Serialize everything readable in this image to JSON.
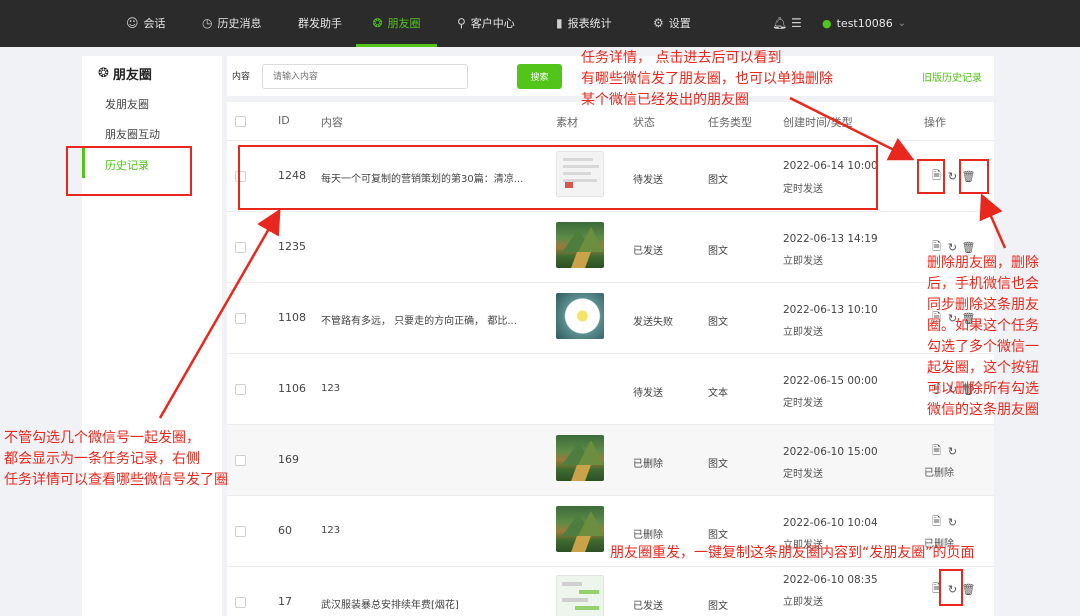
{
  "nav": {
    "items": [
      {
        "icon": "chat-icon",
        "glyph": "☺",
        "label": "会话"
      },
      {
        "icon": "clock-icon",
        "glyph": "◷",
        "label": "历史消息"
      },
      {
        "icon": "",
        "glyph": "",
        "label": "群发助手"
      },
      {
        "icon": "moments-icon",
        "glyph": "❂",
        "label": "朋友圈",
        "active": true
      },
      {
        "icon": "user-icon",
        "glyph": "⚲",
        "label": "客户中心"
      },
      {
        "icon": "bar-chart-icon",
        "glyph": "▮",
        "label": "报表统计"
      },
      {
        "icon": "gear-icon",
        "glyph": "⚙",
        "label": "设置"
      }
    ],
    "username": "test10086"
  },
  "sidebar": {
    "title": "朋友圈",
    "items": [
      "发朋友圈",
      "朋友圈互动",
      "历史记录"
    ],
    "active_index": 2
  },
  "search": {
    "label": "内容",
    "placeholder": "请输入内容",
    "button": "搜索",
    "old_history_link": "旧版历史记录"
  },
  "table": {
    "headers": {
      "id": "ID",
      "content": "内容",
      "material": "素材",
      "status": "状态",
      "task_type": "任务类型",
      "created": "创建时间/类型",
      "actions": "操作"
    },
    "rows": [
      {
        "id": "1248",
        "content": "每天一个可复制的营销策划的第30篇：清凉...",
        "thumb": "doc",
        "status": "待发送",
        "type": "图文",
        "time": "2022-06-14 10:00",
        "mode": "定时发送",
        "ops": "doc-refresh-delete"
      },
      {
        "id": "1235",
        "content": "",
        "thumb": "landscape",
        "status": "已发送",
        "type": "图文",
        "time": "2022-06-13 14:19",
        "mode": "立即发送",
        "ops": "doc-refresh-delete"
      },
      {
        "id": "1108",
        "content": "不管路有多远， 只要走的方向正确， 都比...",
        "thumb": "daisy",
        "status": "发送失败",
        "type": "图文",
        "time": "2022-06-13 10:10",
        "mode": "立即发送",
        "ops": "doc-refresh-delete"
      },
      {
        "id": "1106",
        "content": "123",
        "thumb": "",
        "status": "待发送",
        "type": "文本",
        "time": "2022-06-15 00:00",
        "mode": "定时发送",
        "ops": "doc-refresh-delete"
      },
      {
        "id": "169",
        "content": "",
        "thumb": "landscape",
        "status": "已删除",
        "type": "图文",
        "time": "2022-06-10 15:00",
        "mode": "定时发送",
        "ops": "doc-refresh",
        "deleted_label": "已删除"
      },
      {
        "id": "60",
        "content": "123",
        "thumb": "landscape",
        "status": "已删除",
        "type": "图文",
        "time": "2022-06-10 10:04",
        "mode": "立即发送",
        "ops": "doc-refresh",
        "deleted_label": "已删除"
      },
      {
        "id": "17",
        "content": "武汉服装暴总安排续年费[烟花]",
        "thumb": "chat",
        "status": "已发送",
        "type": "图文",
        "time": "2022-06-10 08:35",
        "mode": "立即发送",
        "ops": "doc-refresh-delete"
      }
    ]
  },
  "annotations": {
    "top": [
      "任务详情，  点击进去后可以看到",
      "有哪些微信发了朋友圈，也可以单独删除",
      "某个微信已经发出的朋友圈"
    ],
    "right": [
      "删除朋友圈，删除",
      "后，手机微信也会",
      "同步删除这条朋友",
      "圈。如果这个任务",
      "勾选了多个微信一",
      "起发圈，这个按钮",
      "可以删除所有勾选",
      "微信的这条朋友圈"
    ],
    "left": [
      "不管勾选几个微信号一起发圈，",
      "都会显示为一条任务记录，右侧",
      "任务详情可以查看哪些微信号发了圈"
    ],
    "bottom": "朋友圈重发，一键复制这条朋友圈内容到“发朋友圈”的页面"
  },
  "colors": {
    "accent": "#52c41a",
    "annotation": "#e8281e",
    "topbar": "#2b2b2b"
  }
}
